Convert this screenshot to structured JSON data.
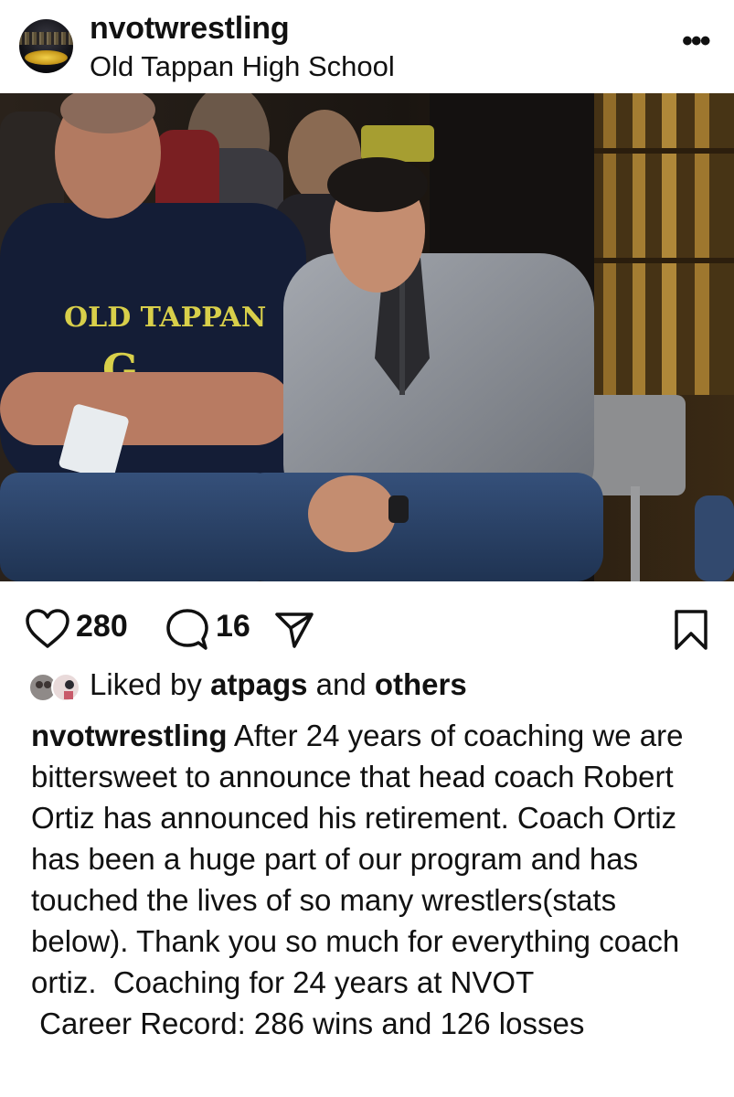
{
  "post": {
    "username": "nvotwrestling",
    "location": "Old Tappan High School",
    "more_icon": "more-horizontal-icon"
  },
  "photo": {
    "shirt_text": "OLD TAPPAN",
    "colors": {
      "shirt_print": "#d8cf4a",
      "navy_shirt": "#15203a",
      "grey_quarterzip": "#8a8d94"
    }
  },
  "actions": {
    "like_count": "280",
    "comment_count": "16",
    "icons": [
      "heart-icon",
      "comment-icon",
      "share-icon",
      "bookmark-icon"
    ]
  },
  "likes": {
    "prefix": "Liked by ",
    "user": "atpags",
    "middle": " and ",
    "others": "others"
  },
  "caption": {
    "username": "nvotwrestling",
    "text": " After 24 years of coaching we are bittersweet to announce that head coach Robert Ortiz has announced his retirement. Coach Ortiz has been a huge part of our program and has touched the lives of so many wrestlers(stats below). Thank you so much for everything coach ortiz.  Coaching for 24 years at NVOT",
    "record": " Career Record: 286 wins and 126 losses"
  }
}
